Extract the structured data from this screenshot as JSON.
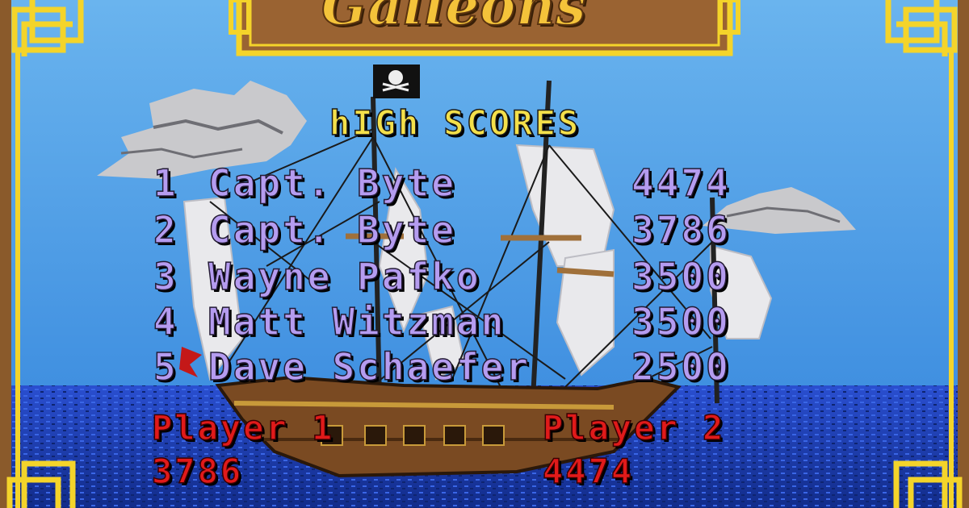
{
  "game_title": "Galleons",
  "high_scores": {
    "heading": "hIGh SCORES",
    "entries": [
      {
        "rank": "1",
        "name": "Capt. Byte",
        "score": "4474"
      },
      {
        "rank": "2",
        "name": "Capt. Byte",
        "score": "3786"
      },
      {
        "rank": "3",
        "name": "Wayne Pafko",
        "score": "3500"
      },
      {
        "rank": "4",
        "name": "Matt Witzman",
        "score": "3500"
      },
      {
        "rank": "5",
        "name": "Dave Schaefer",
        "score": "2500"
      }
    ]
  },
  "players": [
    {
      "label": "Player 1",
      "score": "3786"
    },
    {
      "label": "Player 2",
      "score": "4474"
    }
  ],
  "colors": {
    "sky": "#5aa8e8",
    "sea": "#1a3fb8",
    "frame": "#8a5a2b",
    "gold_border": "#f4d42a",
    "heading": "#f4e04a",
    "score_rows": "#b59cf0",
    "player_text": "#e01a1a"
  }
}
